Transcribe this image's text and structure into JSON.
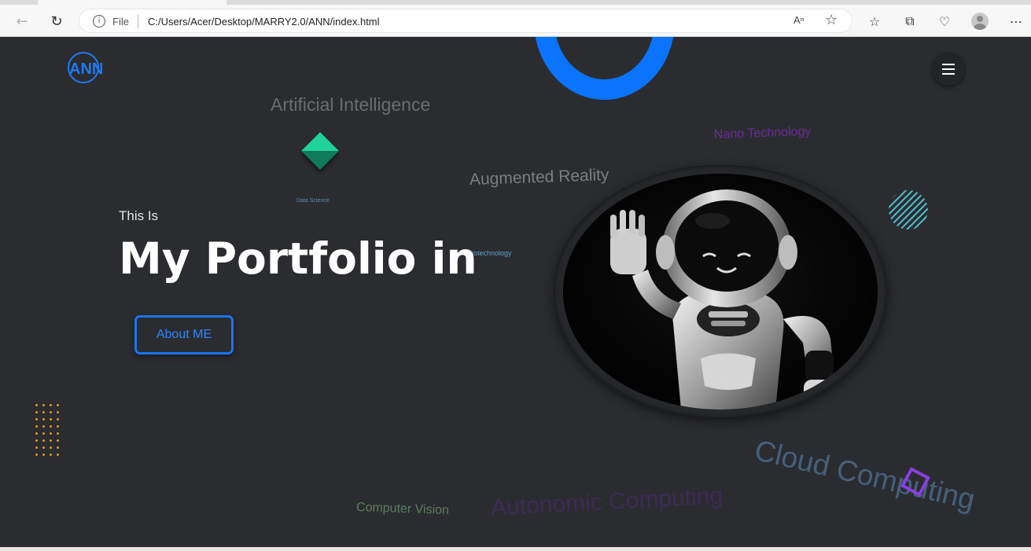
{
  "browser": {
    "file_label": "File",
    "url": "C:/Users/Acer/Desktop/MARRY2.0/ANN/index.html",
    "read_aloud_label": "A¹¹",
    "icons": [
      "back-arrow-icon",
      "reload-icon",
      "info-icon",
      "read-aloud-icon",
      "favorite-star-icon",
      "favorites-list-icon",
      "collections-icon",
      "browser-essentials-icon",
      "profile-avatar",
      "more-icon"
    ]
  },
  "site": {
    "logo_text": "ANN",
    "intro": "This Is",
    "headline": "My Portfolio in",
    "about_button": "About ME"
  },
  "floating_words": {
    "ai": "Artificial Intelligence",
    "data_science": "Data Science",
    "ar": "Augmented Reality",
    "nano": "Nano Technology",
    "bio": "Biotechnology",
    "cloud": "Cloud Computing",
    "cv": "Computer Vision",
    "autonomic": "Autonomic Computing"
  },
  "colors": {
    "background": "#2b2c30",
    "accent_blue": "#0a74ff",
    "dots_orange": "#e59a1c",
    "square_purple": "#8a3ee6",
    "diamond_green": "#1ed29a"
  }
}
